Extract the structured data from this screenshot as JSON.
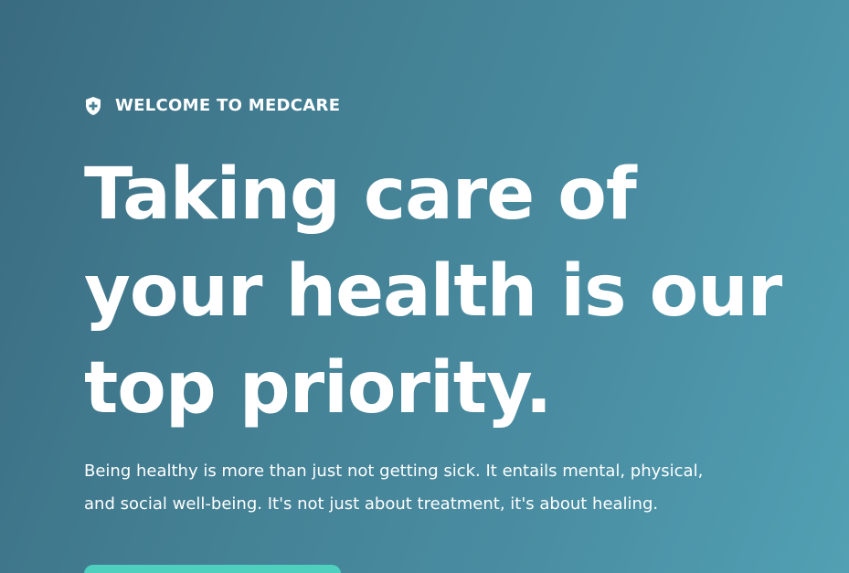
{
  "hero": {
    "eyebrow": {
      "icon": "shield-plus-icon",
      "text": "WELCOME TO MEDCARE"
    },
    "headline_lines": [
      "Taking care of",
      "your health is our",
      "top priority."
    ],
    "description_lines": [
      "Being healthy is more than just not getting sick. It entails mental, physical,",
      "and social well-being. It's not just about treatment, it's about healing."
    ],
    "cta": {
      "color": "#4fd0bf"
    }
  },
  "colors": {
    "background_start": "#3a6b80",
    "background_end": "#52a0b3",
    "text": "#ffffff",
    "accent": "#4fd0bf"
  }
}
